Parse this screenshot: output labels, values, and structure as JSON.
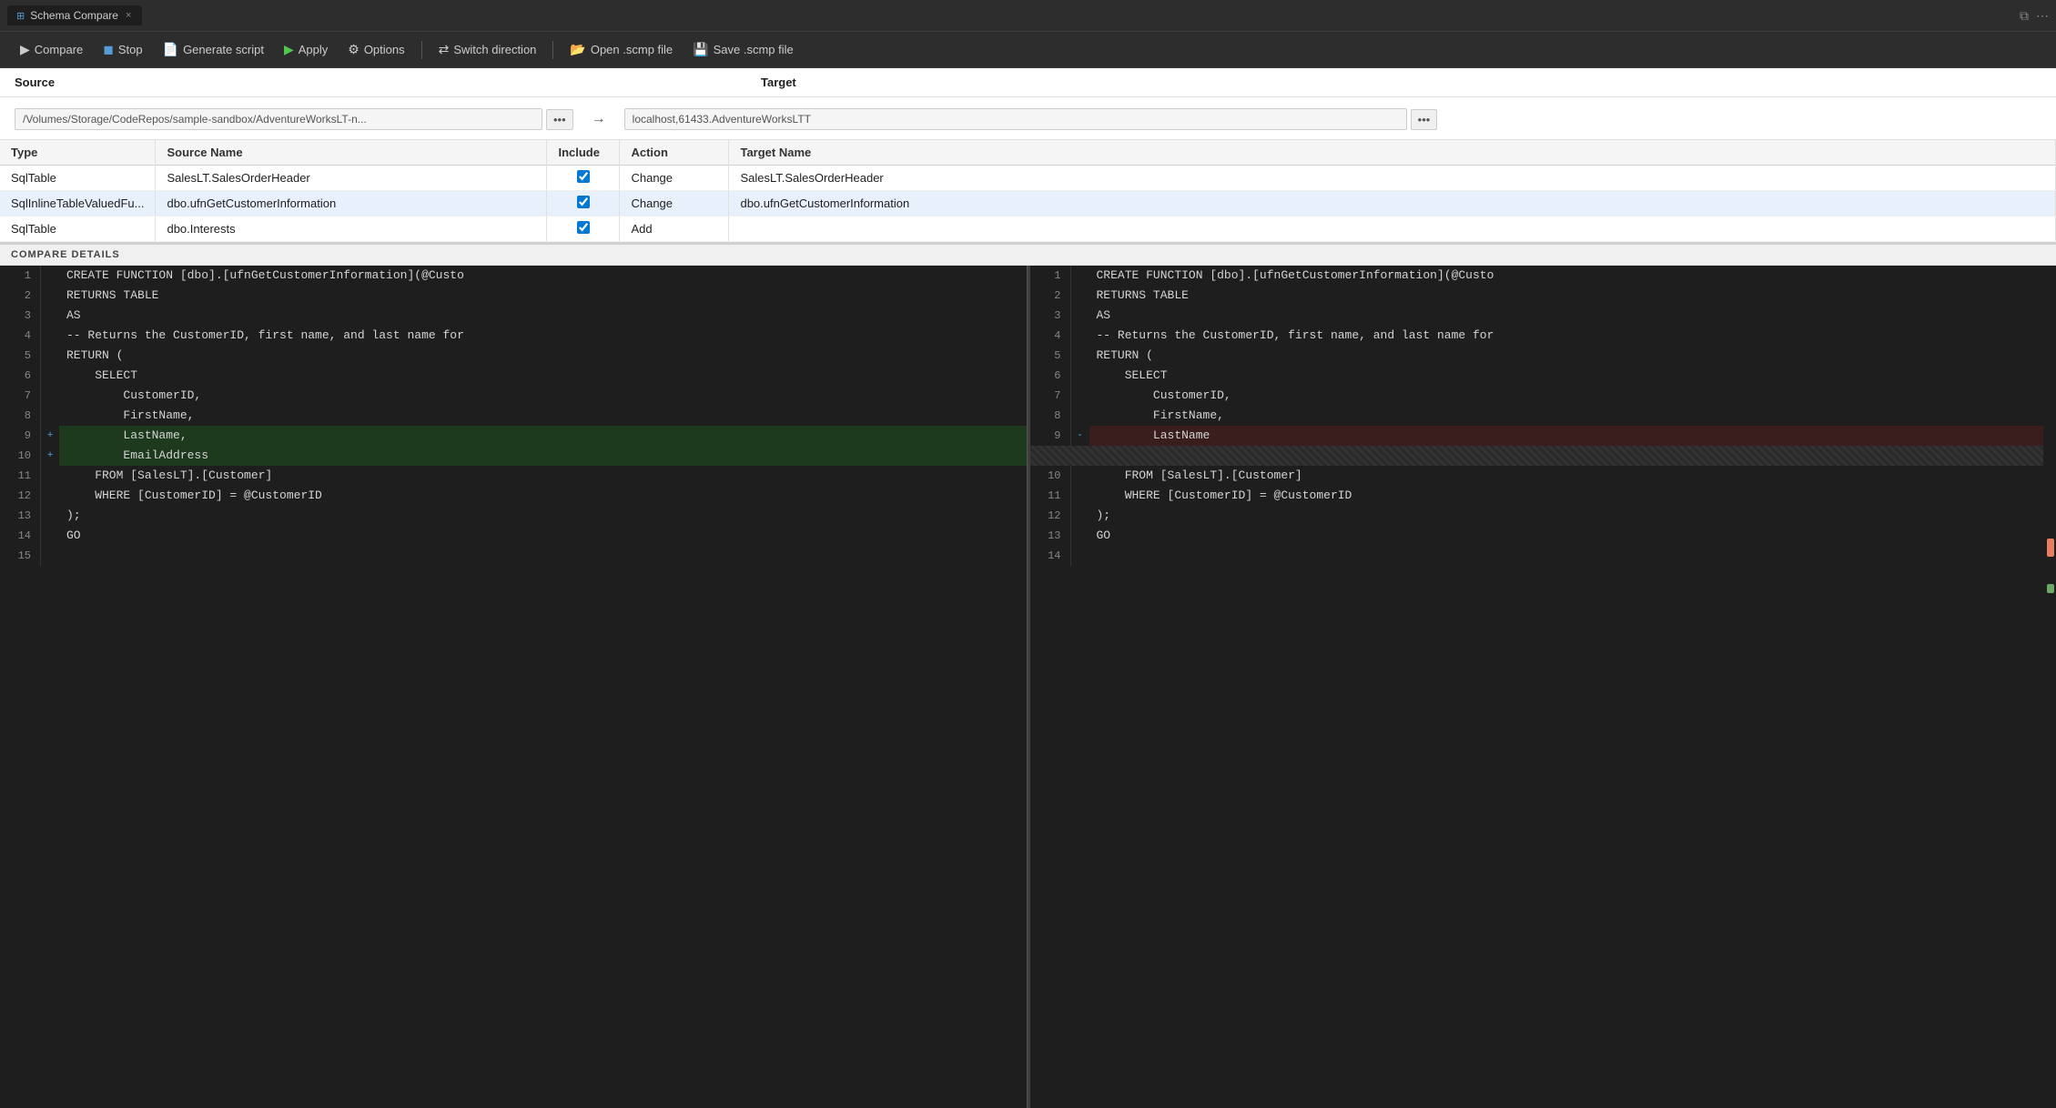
{
  "tab": {
    "icon": "⊞",
    "label": "Schema Compare",
    "close": "×"
  },
  "toolbar": {
    "compare_label": "Compare",
    "stop_label": "Stop",
    "generate_script_label": "Generate script",
    "apply_label": "Apply",
    "options_label": "Options",
    "switch_direction_label": "Switch direction",
    "open_scmp_label": "Open .scmp file",
    "save_scmp_label": "Save .scmp file"
  },
  "source": {
    "section_label": "Source",
    "path": "/Volumes/Storage/CodeRepos/sample-sandbox/AdventureWorksLT-n..."
  },
  "target": {
    "section_label": "Target",
    "path": "localhost,61433.AdventureWorksLTT"
  },
  "table": {
    "headers": [
      "Type",
      "Source Name",
      "Include",
      "Action",
      "Target Name"
    ],
    "rows": [
      {
        "type": "SqlTable",
        "source_name": "SalesLT.SalesOrderHeader",
        "include": true,
        "action": "Change",
        "target_name": "SalesLT.SalesOrderHeader",
        "selected": false
      },
      {
        "type": "SqlInlineTableValuedFu...",
        "source_name": "dbo.ufnGetCustomerInformation",
        "include": true,
        "action": "Change",
        "target_name": "dbo.ufnGetCustomerInformation",
        "selected": true
      },
      {
        "type": "SqlTable",
        "source_name": "dbo.Interests",
        "include": true,
        "action": "Add",
        "target_name": "",
        "selected": false
      }
    ]
  },
  "compare_details": {
    "header": "COMPARE DETAILS"
  },
  "source_code": [
    {
      "num": 1,
      "gutter": "",
      "content": "CREATE FUNCTION [dbo].[ufnGetCustomerInformation](@Custo",
      "style": ""
    },
    {
      "num": 2,
      "gutter": "",
      "content": "RETURNS TABLE",
      "style": ""
    },
    {
      "num": 3,
      "gutter": "",
      "content": "AS",
      "style": ""
    },
    {
      "num": 4,
      "gutter": "",
      "content": "-- Returns the CustomerID, first name, and last name for",
      "style": ""
    },
    {
      "num": 5,
      "gutter": "",
      "content": "RETURN (",
      "style": ""
    },
    {
      "num": 6,
      "gutter": "",
      "content": "    SELECT",
      "style": ""
    },
    {
      "num": 7,
      "gutter": "",
      "content": "        CustomerID,",
      "style": ""
    },
    {
      "num": 8,
      "gutter": "",
      "content": "        FirstName,",
      "style": ""
    },
    {
      "num": 9,
      "gutter": "+",
      "content": "        LastName,",
      "style": "added"
    },
    {
      "num": 10,
      "gutter": "+",
      "content": "        EmailAddress",
      "style": "added"
    },
    {
      "num": 11,
      "gutter": "",
      "content": "    FROM [SalesLT].[Customer]",
      "style": ""
    },
    {
      "num": 12,
      "gutter": "",
      "content": "    WHERE [CustomerID] = @CustomerID",
      "style": ""
    },
    {
      "num": 13,
      "gutter": "",
      "content": ");",
      "style": ""
    },
    {
      "num": 14,
      "gutter": "",
      "content": "GO",
      "style": ""
    },
    {
      "num": 15,
      "gutter": "",
      "content": "",
      "style": ""
    }
  ],
  "target_code": [
    {
      "num": 1,
      "gutter": "",
      "content": "CREATE FUNCTION [dbo].[ufnGetCustomerInformation](@Custo",
      "style": ""
    },
    {
      "num": 2,
      "gutter": "",
      "content": "RETURNS TABLE",
      "style": ""
    },
    {
      "num": 3,
      "gutter": "",
      "content": "AS",
      "style": ""
    },
    {
      "num": 4,
      "gutter": "",
      "content": "-- Returns the CustomerID, first name, and last name for",
      "style": ""
    },
    {
      "num": 5,
      "gutter": "",
      "content": "RETURN (",
      "style": ""
    },
    {
      "num": 6,
      "gutter": "",
      "content": "    SELECT",
      "style": ""
    },
    {
      "num": 7,
      "gutter": "",
      "content": "        CustomerID,",
      "style": ""
    },
    {
      "num": 8,
      "gutter": "",
      "content": "        FirstName,",
      "style": ""
    },
    {
      "num": 9,
      "gutter": "-",
      "content": "        LastName",
      "style": "removed"
    },
    {
      "num": 10,
      "gutter": "",
      "content": "",
      "style": "deleted-placeholder"
    },
    {
      "num": 10,
      "gutter": "",
      "content": "    FROM [SalesLT].[Customer]",
      "style": ""
    },
    {
      "num": 11,
      "gutter": "",
      "content": "    WHERE [CustomerID] = @CustomerID",
      "style": ""
    },
    {
      "num": 12,
      "gutter": "",
      "content": ");",
      "style": ""
    },
    {
      "num": 13,
      "gutter": "",
      "content": "GO",
      "style": ""
    },
    {
      "num": 14,
      "gutter": "",
      "content": "",
      "style": ""
    }
  ]
}
